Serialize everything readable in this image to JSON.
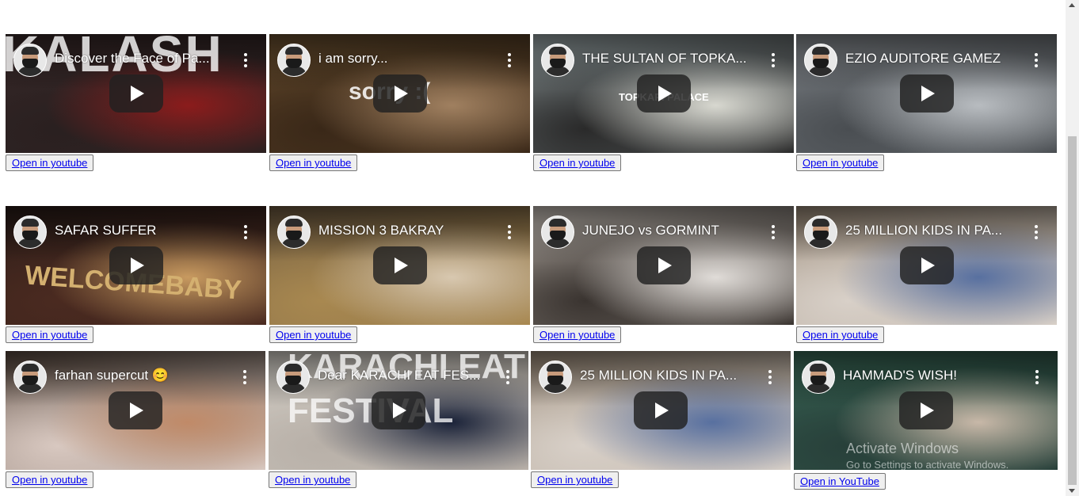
{
  "videos": [
    {
      "title": "Discover the Face of Pa...",
      "overlay": "KALASH",
      "button": "Open in youtube",
      "colors": [
        "#3a2a2a",
        "#8b1c1c",
        "#2a2020"
      ]
    },
    {
      "title": "i am sorry...",
      "overlay": "sorry :(",
      "button": "Open in youtube",
      "colors": [
        "#6b5030",
        "#a08060",
        "#3a2818"
      ]
    },
    {
      "title": "THE SULTAN OF TOPKA...",
      "overlay": "TOPKAPI PALACE",
      "button": "Open in youtube",
      "colors": [
        "#9aa6a8",
        "#d8d8d0",
        "#2a2a2a"
      ]
    },
    {
      "title": "EZIO AUDITORE GAMEZ",
      "overlay": "",
      "button": "Open in youtube",
      "colors": [
        "#8a8f94",
        "#b8bcc0",
        "#4a4e52"
      ]
    },
    {
      "title": "SAFAR SUFFER",
      "overlay": "WELCOMEBABY",
      "button": "Open in youtube",
      "colors": [
        "#2a1c18",
        "#c89a60",
        "#4a2a20"
      ]
    },
    {
      "title": "MISSION 3 BAKRAY",
      "overlay": "",
      "button": "Open in youtube",
      "colors": [
        "#6e5a40",
        "#d8c8b0",
        "#a88850"
      ]
    },
    {
      "title": "JUNEJO vs GORMINT",
      "overlay": "",
      "button": "Open in youtube",
      "colors": [
        "#c8c0b8",
        "#e0dcd8",
        "#3a3430"
      ]
    },
    {
      "title": "25 MILLION KIDS IN PA...",
      "overlay": "",
      "button": "Open in youtube",
      "colors": [
        "#9a8a78",
        "#5870a0",
        "#d8d0c8"
      ]
    },
    {
      "title": "farhan supercut 😊",
      "overlay": "",
      "button": "Open in youtube",
      "colors": [
        "#5a4a40",
        "#c08a68",
        "#d8c8c0"
      ]
    },
    {
      "title": "Dear KARACHI EAT FES...",
      "overlay": "KARACHI EAT FESTIVAL",
      "button": "Open in youtube",
      "colors": [
        "#d8d4cc",
        "#1a2238",
        "#b8b0a8"
      ]
    },
    {
      "title": "25 MILLION KIDS IN PA...",
      "overlay": "",
      "button": "Open in youtube",
      "colors": [
        "#9a8a78",
        "#5870a0",
        "#d8d0c8"
      ]
    },
    {
      "title": "HAMMAD'S WISH!",
      "overlay": "",
      "button": "Open in YouTube",
      "colors": [
        "#3a6a58",
        "#c8b8a8",
        "#28403a"
      ]
    }
  ],
  "watermark": {
    "title": "Activate Windows",
    "subtitle": "Go to Settings to activate Windows."
  }
}
